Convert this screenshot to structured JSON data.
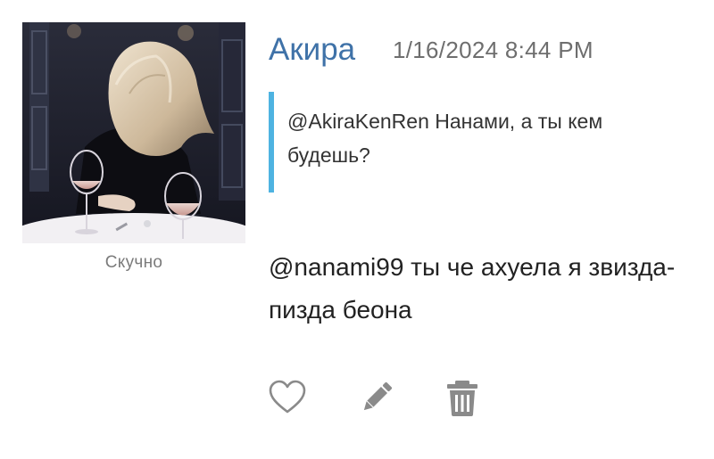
{
  "post": {
    "author": "Акира",
    "timestamp": "1/16/2024 8:44 PM",
    "status": "Скучно",
    "quote": {
      "text": "@AkiraKenRen Нанами, а ты кем будешь?"
    },
    "message": "@nanami99 ты че ахуела я звизда-пизда беона"
  },
  "actions": {
    "like_icon": "heart-outline-icon",
    "edit_icon": "pencil-icon",
    "delete_icon": "trash-icon"
  },
  "colors": {
    "author": "#3f72a8",
    "quote_bar": "#4eb3e1",
    "icons": "#8a8a8a"
  }
}
